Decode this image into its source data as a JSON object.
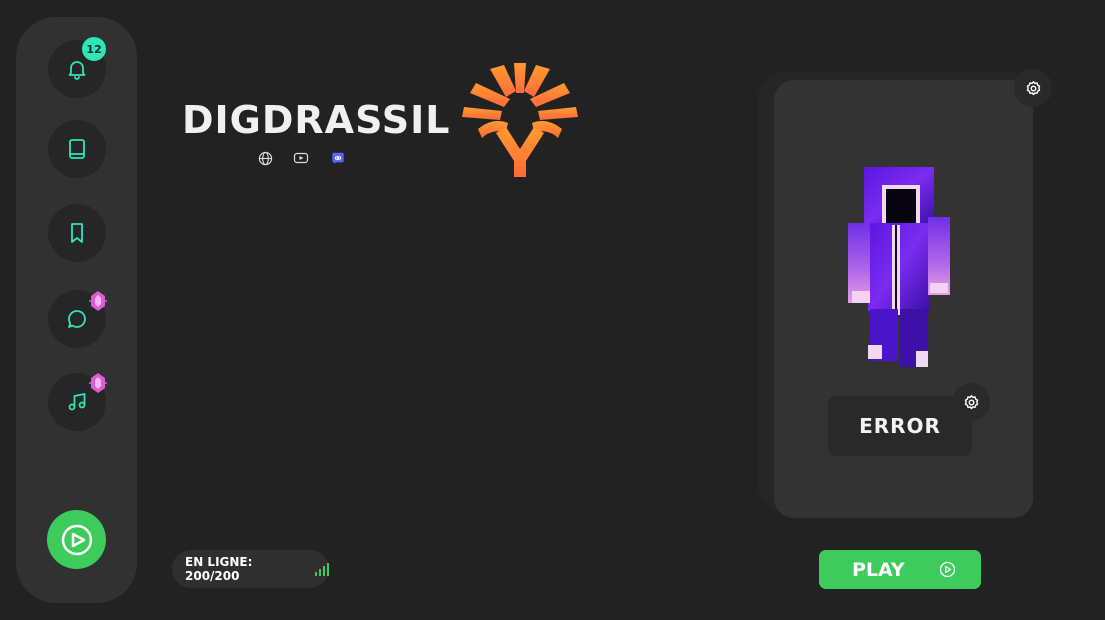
{
  "sidebar": {
    "notifications": {
      "icon": "bell-icon",
      "badge": "12"
    },
    "items": [
      {
        "icon": "book-icon"
      },
      {
        "icon": "bookmark-icon"
      },
      {
        "icon": "chat-bubble-icon",
        "tag_icon": "gem-icon"
      },
      {
        "icon": "music-note-icon",
        "tag_icon": "gem-icon"
      }
    ],
    "play_icon": "play-circle-icon"
  },
  "server": {
    "name": "DIGDRASSIL",
    "socials": [
      "globe-icon",
      "youtube-icon",
      "discord-icon"
    ],
    "logo": "yggdrasil-tree-logo"
  },
  "status": {
    "online_label": "EN LIGNE: 200/200",
    "signal_icon": "signal-bars-icon"
  },
  "profile": {
    "card_settings_icon": "gear-icon",
    "skin_icon": "player-skin-icon",
    "username": "ERROR",
    "username_settings_icon": "gear-icon",
    "play_label": "PLAY",
    "play_icon": "play-circle-icon"
  },
  "colors": {
    "accent_teal": "#2ee6b8",
    "accent_green": "#3dcc5c",
    "gem_pink": "#e05ad8",
    "logo_orange": "#ff7a3a",
    "background": "#222222",
    "panel": "#313131"
  }
}
